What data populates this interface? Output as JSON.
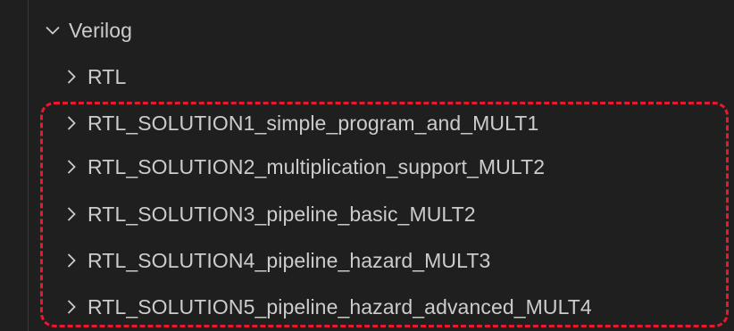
{
  "explorer": {
    "root": {
      "label": "Verilog",
      "icon": "chevron-down-icon",
      "expanded": true
    },
    "children": [
      {
        "label": "RTL",
        "icon": "chevron-right-icon"
      },
      {
        "label": "RTL_SOLUTION1_simple_program_and_MULT1",
        "icon": "chevron-right-icon"
      },
      {
        "label": "RTL_SOLUTION2_multiplication_support_MULT2",
        "icon": "chevron-right-icon"
      },
      {
        "label": "RTL_SOLUTION3_pipeline_basic_MULT2",
        "icon": "chevron-right-icon"
      },
      {
        "label": "RTL_SOLUTION4_pipeline_hazard_MULT3",
        "icon": "chevron-right-icon"
      },
      {
        "label": "RTL_SOLUTION5_pipeline_hazard_advanced_MULT4",
        "icon": "chevron-right-icon"
      }
    ]
  },
  "colors": {
    "background": "#1f1f1f",
    "text": "#cccccc",
    "highlight": "#e8192c"
  }
}
